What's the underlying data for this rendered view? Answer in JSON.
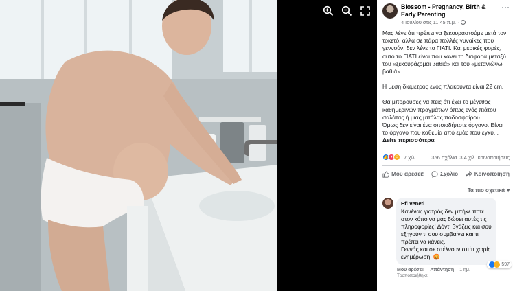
{
  "viewer": {
    "zoom_in_icon": "zoom-in-icon",
    "zoom_out_icon": "zoom-out-icon",
    "fullscreen_icon": "fullscreen-icon"
  },
  "post": {
    "page_name": "Blossom - Pregnancy, Birth & Early Parenting",
    "meta_time": "4 Ιουλίου στις 11:45 π.μ.",
    "meta_separator": "·",
    "paragraphs": [
      "Μας λένε ότι πρέπει να ξεκουραστούμε μετά τον τοκετό, αλλά σε πάρα πολλές γυναίκες που γεννούν, δεν λένε το ΓΙΑΤΙ. Και μερικές φορές, αυτό το ΓΙΑΤΙ είναι που κάνει τη διαφορά μεταξύ του «ξεκουράζομαι βαθιά» και του «μετανιώνω βαθιά».",
      "Η μέση διάμετρος ενός πλακούντα είναι 22 cm.",
      "Θα μπορούσες να πεις ότι έχει το μέγεθος καθημερινών πραγμάτων όπως ενός πιάτου σαλάτας ή μιας μπάλας ποδοσφαίρου.",
      "Όμως δεν είναι ένα οποιοδήποτε όργανο. Είναι το όργανο που καθεμία από εμάς που εγκυ..."
    ],
    "see_more": "Δείτε περισσότερα",
    "reactions_count": "7 χιλ.",
    "comments_count": "356 σχόλια",
    "shares_count": "3,4 χιλ. κοινοποιήσεις",
    "actions": {
      "like": "Μου αρέσει!",
      "comment": "Σχόλιο",
      "share": "Κοινοποίηση"
    },
    "sort_label": "Τα πιο σχετικά"
  },
  "comment": {
    "author": "Efi Veneti",
    "lines_a": "Κανένας γιατρός δεν μπήκε ποτέ στον κόπο να μας δώσει αυτές τις πληροφορίες! Δόντι βγάζεις και σου εξηγούν τι σου συμβαίνει και τι πρέπει να κάνεις.",
    "lines_b": "Γεννάς και σε στέλνουν σπίτι χωρίς ενημέρωση! 😡",
    "reaction_count": "597",
    "like_label": "Μου αρέσει!",
    "reply_label": "Απάντηση",
    "time": "1 ημ.",
    "edited": "Τροποποιήθηκε"
  },
  "colors": {
    "accent": "#1877f2",
    "love": "#f33e58",
    "care": "#f7b125",
    "panel_bg": "#ffffff",
    "bubble_bg": "#f0f2f5"
  }
}
